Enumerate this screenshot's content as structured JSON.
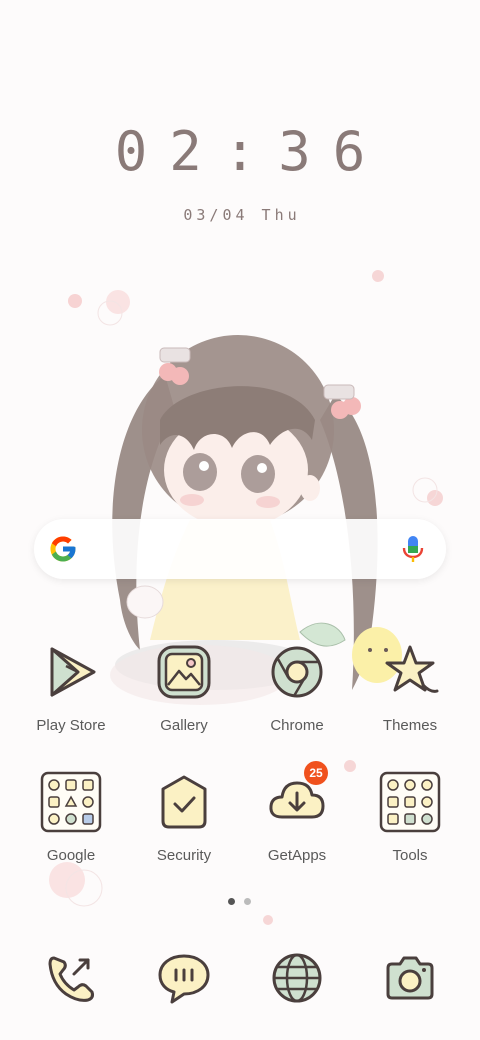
{
  "lockscreen": {
    "time": "02:36",
    "date": "03/04 Thu"
  },
  "search": {
    "logo_icon": "google-g-icon",
    "mic_icon": "microphone-icon"
  },
  "home_row_1": [
    {
      "label": "Play Store",
      "icon": "play-store-icon"
    },
    {
      "label": "Gallery",
      "icon": "gallery-icon"
    },
    {
      "label": "Chrome",
      "icon": "chrome-icon"
    },
    {
      "label": "Themes",
      "icon": "themes-icon"
    }
  ],
  "home_row_2": [
    {
      "label": "Google",
      "icon": "google-folder-icon"
    },
    {
      "label": "Security",
      "icon": "security-icon"
    },
    {
      "label": "GetApps",
      "icon": "getapps-icon",
      "badge": "25"
    },
    {
      "label": "Tools",
      "icon": "tools-folder-icon"
    }
  ],
  "page_indicator": {
    "pages": 2,
    "active": 0
  },
  "dock": [
    {
      "icon": "phone-icon"
    },
    {
      "icon": "messages-icon"
    },
    {
      "icon": "browser-icon"
    },
    {
      "icon": "camera-icon"
    }
  ],
  "colors": {
    "icon_fill": "#fbf1c4",
    "icon_stroke": "#4a3f3d",
    "icon_green": "#cfe0cf",
    "badge": "#f0511d",
    "clock": "#8a7a78"
  }
}
